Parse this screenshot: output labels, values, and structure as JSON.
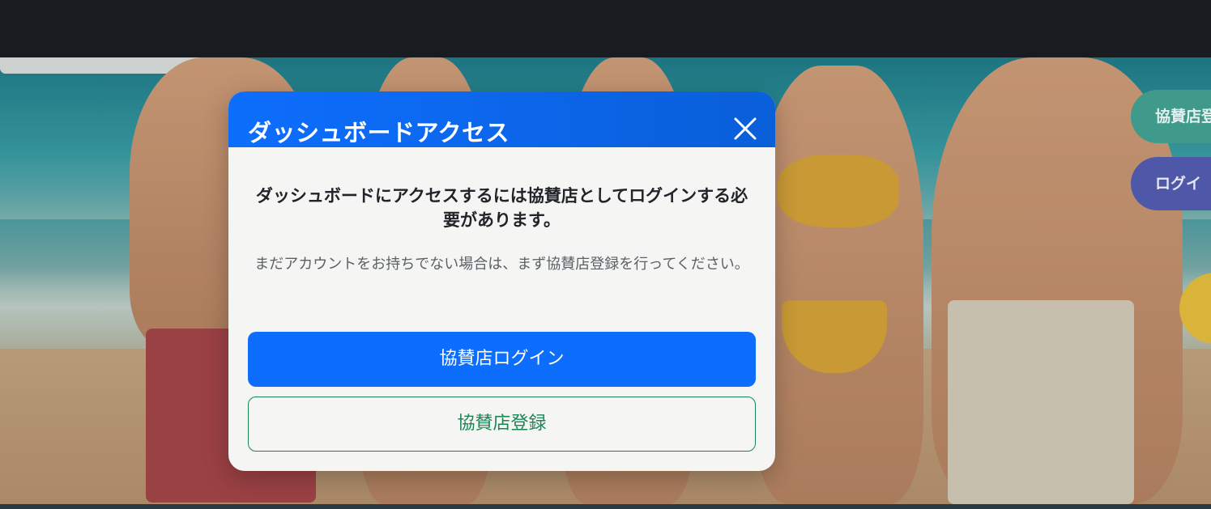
{
  "modal": {
    "title": "ダッシュボードアクセス",
    "lead_text": "ダッシュボードにアクセスするには協賛店としてログインする必要があります。",
    "sub_text": "まだアカウントをお持ちでない場合は、まず協賛店登録を行ってください。",
    "primary_button_label": "協賛店ログイン",
    "secondary_button_label": "協賛店登録",
    "close_icon": "close-icon"
  },
  "side_buttons": {
    "register_label": "協賛店登",
    "login_label": "ログイ"
  },
  "colors": {
    "primary": "#0d6efd",
    "success": "#198754",
    "top_bar": "#181b1f"
  }
}
